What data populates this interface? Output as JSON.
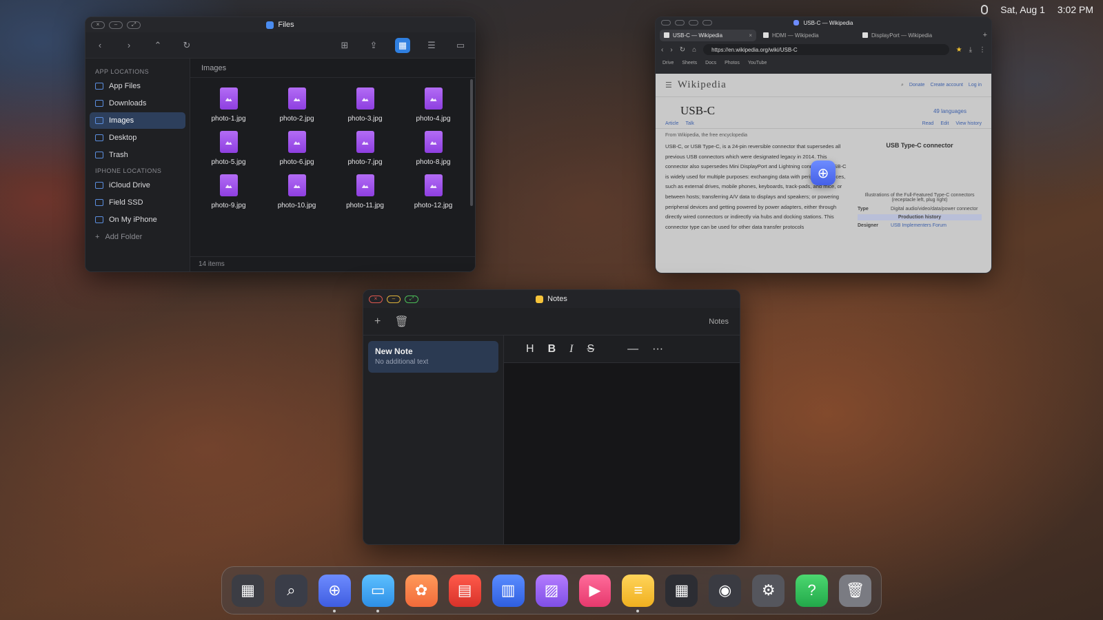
{
  "menubar": {
    "date": "Sat, Aug 1",
    "time": "3:02 PM"
  },
  "files": {
    "title": "Files",
    "crumb": "Images",
    "status": "14 items",
    "sections": [
      {
        "label": "APP LOCATIONS",
        "items": [
          "App Files",
          "Downloads",
          "Images",
          "Desktop",
          "Trash"
        ]
      },
      {
        "label": "IPHONE LOCATIONS",
        "items": [
          "iCloud Drive",
          "Field SSD",
          "On My iPhone"
        ]
      }
    ],
    "add_folder": "Add Folder",
    "grid": [
      "photo-1.jpg",
      "photo-2.jpg",
      "photo-3.jpg",
      "photo-4.jpg",
      "photo-5.jpg",
      "photo-6.jpg",
      "photo-7.jpg",
      "photo-8.jpg",
      "photo-9.jpg",
      "photo-10.jpg",
      "photo-11.jpg",
      "photo-12.jpg"
    ]
  },
  "browser": {
    "title": "USB-C — Wikipedia",
    "tabs": [
      "USB-C — Wikipedia",
      "HDMI — Wikipedia",
      "DisplayPort — Wikipedia"
    ],
    "url": "https://en.wikipedia.org/wiki/USB-C",
    "bookmarks": [
      "Drive",
      "Sheets",
      "Docs",
      "Photos",
      "YouTube"
    ],
    "page": {
      "logo": "Wikipedia",
      "actions": [
        "Donate",
        "Create account",
        "Log in"
      ],
      "heading": "USB-C",
      "languages": "49 languages",
      "subtabs": [
        "Article",
        "Talk",
        "Read",
        "Edit",
        "View history"
      ],
      "from": "From Wikipedia, the free encyclopedia",
      "body": "USB-C, or USB Type-C, is a 24-pin reversible connector that supersedes all previous USB connectors which were designated legacy in 2014. This connector also supersedes Mini DisplayPort and Lightning connectors. USB-C is widely used for multiple purposes: exchanging data with peripheral devices, such as external drives, mobile phones, keyboards, track-pads, and mice, or between hosts; transferring A/V data to displays and speakers; or powering peripheral devices and getting powered by power adapters, either through directly wired connectors or indirectly via hubs and docking stations. This connector type can be used for other data transfer protocols",
      "infobox_title": "USB Type-C connector",
      "infobox_caption": "Illustrations of the Full-Featured Type-C connectors (receptacle left, plug right)",
      "type_label": "Type",
      "type_value": "Digital audio/video/data/power connector",
      "history": "Production history",
      "designer_label": "Designer",
      "designer_value": "USB Implementers Forum"
    }
  },
  "notes": {
    "title": "Notes",
    "toolbar_label": "Notes",
    "note_title": "New Note",
    "note_sub": "No additional text"
  },
  "dock": [
    "launchpad",
    "search",
    "browser",
    "files",
    "photos-flower",
    "pdf",
    "docs",
    "gallery",
    "media",
    "notes",
    "calculator",
    "camera",
    "settings",
    "help",
    "trash"
  ]
}
